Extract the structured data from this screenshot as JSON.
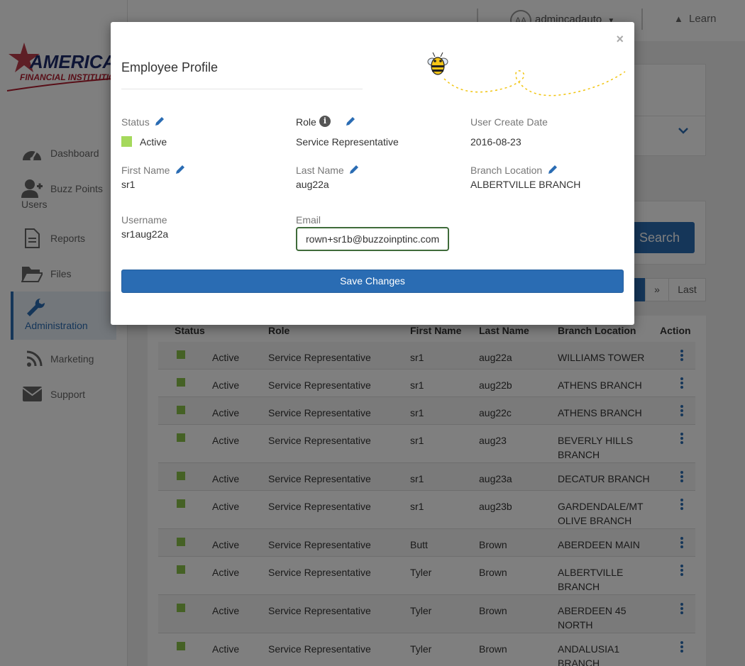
{
  "logo": {
    "text_top": "AMERICAS",
    "text_bottom": "FINANCIAL INSTITUTION"
  },
  "topbar": {
    "avatar_initials": "AA",
    "username": "admincadauto",
    "learn_label": "Learn"
  },
  "sidebar": {
    "items": [
      {
        "label": "Dashboard",
        "icon": "dashboard-icon"
      },
      {
        "label": "Buzz Points",
        "label2": "Users",
        "icon": "user-plus-icon"
      },
      {
        "label": "Reports",
        "icon": "document-icon"
      },
      {
        "label": "Files",
        "icon": "folder-icon"
      },
      {
        "label": "Administration",
        "icon": "wrench-icon",
        "active": true
      },
      {
        "label": "Marketing",
        "icon": "rss-icon"
      },
      {
        "label": "Support",
        "icon": "envelope-icon"
      }
    ]
  },
  "search": {
    "button_label": "Search"
  },
  "pagination": {
    "next_label": "»",
    "last_label": "Last"
  },
  "table": {
    "columns": [
      "Status",
      "Role",
      "First Name",
      "Last Name",
      "Branch Location",
      "Action"
    ],
    "rows": [
      {
        "status": "Active",
        "role": "Service Representative",
        "first": "sr1",
        "last": "aug22a",
        "branch": "WILLIAMS TOWER",
        "branch2": ""
      },
      {
        "status": "Active",
        "role": "Service Representative",
        "first": "sr1",
        "last": "aug22b",
        "branch": "ATHENS BRANCH",
        "branch2": ""
      },
      {
        "status": "Active",
        "role": "Service Representative",
        "first": "sr1",
        "last": "aug22c",
        "branch": "ATHENS BRANCH",
        "branch2": ""
      },
      {
        "status": "Active",
        "role": "Service Representative",
        "first": "sr1",
        "last": "aug23",
        "branch": "BEVERLY HILLS",
        "branch2": "BRANCH"
      },
      {
        "status": "Active",
        "role": "Service Representative",
        "first": "sr1",
        "last": "aug23a",
        "branch": "DECATUR BRANCH",
        "branch2": ""
      },
      {
        "status": "Active",
        "role": "Service Representative",
        "first": "sr1",
        "last": "aug23b",
        "branch": "GARDENDALE/MT",
        "branch2": "OLIVE BRANCH"
      },
      {
        "status": "Active",
        "role": "Service Representative",
        "first": "Butt",
        "last": "Brown",
        "branch": "ABERDEEN MAIN",
        "branch2": ""
      },
      {
        "status": "Active",
        "role": "Service Representative",
        "first": "Tyler",
        "last": "Brown",
        "branch": "ALBERTVILLE",
        "branch2": "BRANCH"
      },
      {
        "status": "Active",
        "role": "Service Representative",
        "first": "Tyler",
        "last": "Brown",
        "branch": "ABERDEEN 45",
        "branch2": "NORTH"
      },
      {
        "status": "Active",
        "role": "Service Representative",
        "first": "Tyler",
        "last": "Brown",
        "branch": "ANDALUSIA1",
        "branch2": "BRANCH"
      }
    ]
  },
  "modal": {
    "title": "Employee Profile",
    "close_label": "×",
    "status_label": "Status",
    "status_value": "Active",
    "role_label": "Role",
    "role_value": "Service Representative",
    "create_date_label": "User Create Date",
    "create_date_value": "2016-08-23",
    "first_name_label": "First Name",
    "first_name_value": "sr1",
    "last_name_label": "Last Name",
    "last_name_value": "aug22a",
    "branch_label": "Branch Location",
    "branch_value": "ALBERTVILLE BRANCH",
    "username_label": "Username",
    "username_value": "sr1aug22a",
    "email_label": "Email",
    "email_value": "rown+sr1b@buzzoinptinc.com",
    "save_label": "Save Changes"
  },
  "colors": {
    "primary": "#2a6cb3",
    "status_active": "#8bc34a",
    "status_swatch_modal": "#a5d95c"
  }
}
